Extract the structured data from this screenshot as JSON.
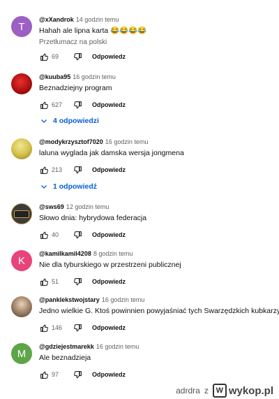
{
  "comments": [
    {
      "author": "@xXandrok",
      "time": "14 godzin temu",
      "text": "Hahah ale lipna karta 😂😂😂😂",
      "translate": "Przetłumacz na polski",
      "likes": "69",
      "reply": "Odpowiedz",
      "avatar_letter": "T",
      "avatar_color": "#9c5fc4"
    },
    {
      "author": "@kuuba95",
      "time": "16 godzin temu",
      "text": "Beznadziejny program",
      "likes": "627",
      "reply": "Odpowiedz",
      "avatar_letter": "",
      "avatar_color": "#c21a1a",
      "replies": "4 odpowiedzi"
    },
    {
      "author": "@modykrzysztof7020",
      "time": "16 godzin temu",
      "text": "laluna wyglada jak damska wersja jongmena",
      "likes": "213",
      "reply": "Odpowiedz",
      "avatar_letter": "",
      "avatar_color": "#d6c34a",
      "replies": "1 odpowiedź"
    },
    {
      "author": "@sws69",
      "time": "12 godzin temu",
      "text": "Słowo dnia: hybrydowa federacja",
      "likes": "40",
      "reply": "Odpowiedz",
      "avatar_letter": "",
      "avatar_color": "#3b3b3b"
    },
    {
      "author": "@kamilkamil4208",
      "time": "8 godzin temu",
      "text": "Nie dla tyburskiego w przestrzeni publicznej",
      "likes": "51",
      "reply": "Odpowiedz",
      "avatar_letter": "K",
      "avatar_color": "#e8447a"
    },
    {
      "author": "@panklekstwojstary",
      "time": "16 godzin temu",
      "text": "Jedno wielkie G. Ktoś powinnien powyjaśniać tych Swarzędzkich kubkarzy",
      "likes": "146",
      "reply": "Odpowiedz",
      "avatar_letter": "",
      "avatar_color": "#7a6a5a"
    },
    {
      "author": "@gdziejestmarekk",
      "time": "16 godzin temu",
      "text": "Ale beznadzieja",
      "likes": "97",
      "reply": "Odpowiedz",
      "avatar_letter": "M",
      "avatar_color": "#5ea548"
    }
  ],
  "watermark": {
    "user": "adrdra",
    "separator": "z",
    "site": "wykop.pl",
    "logo_letter": "W"
  }
}
